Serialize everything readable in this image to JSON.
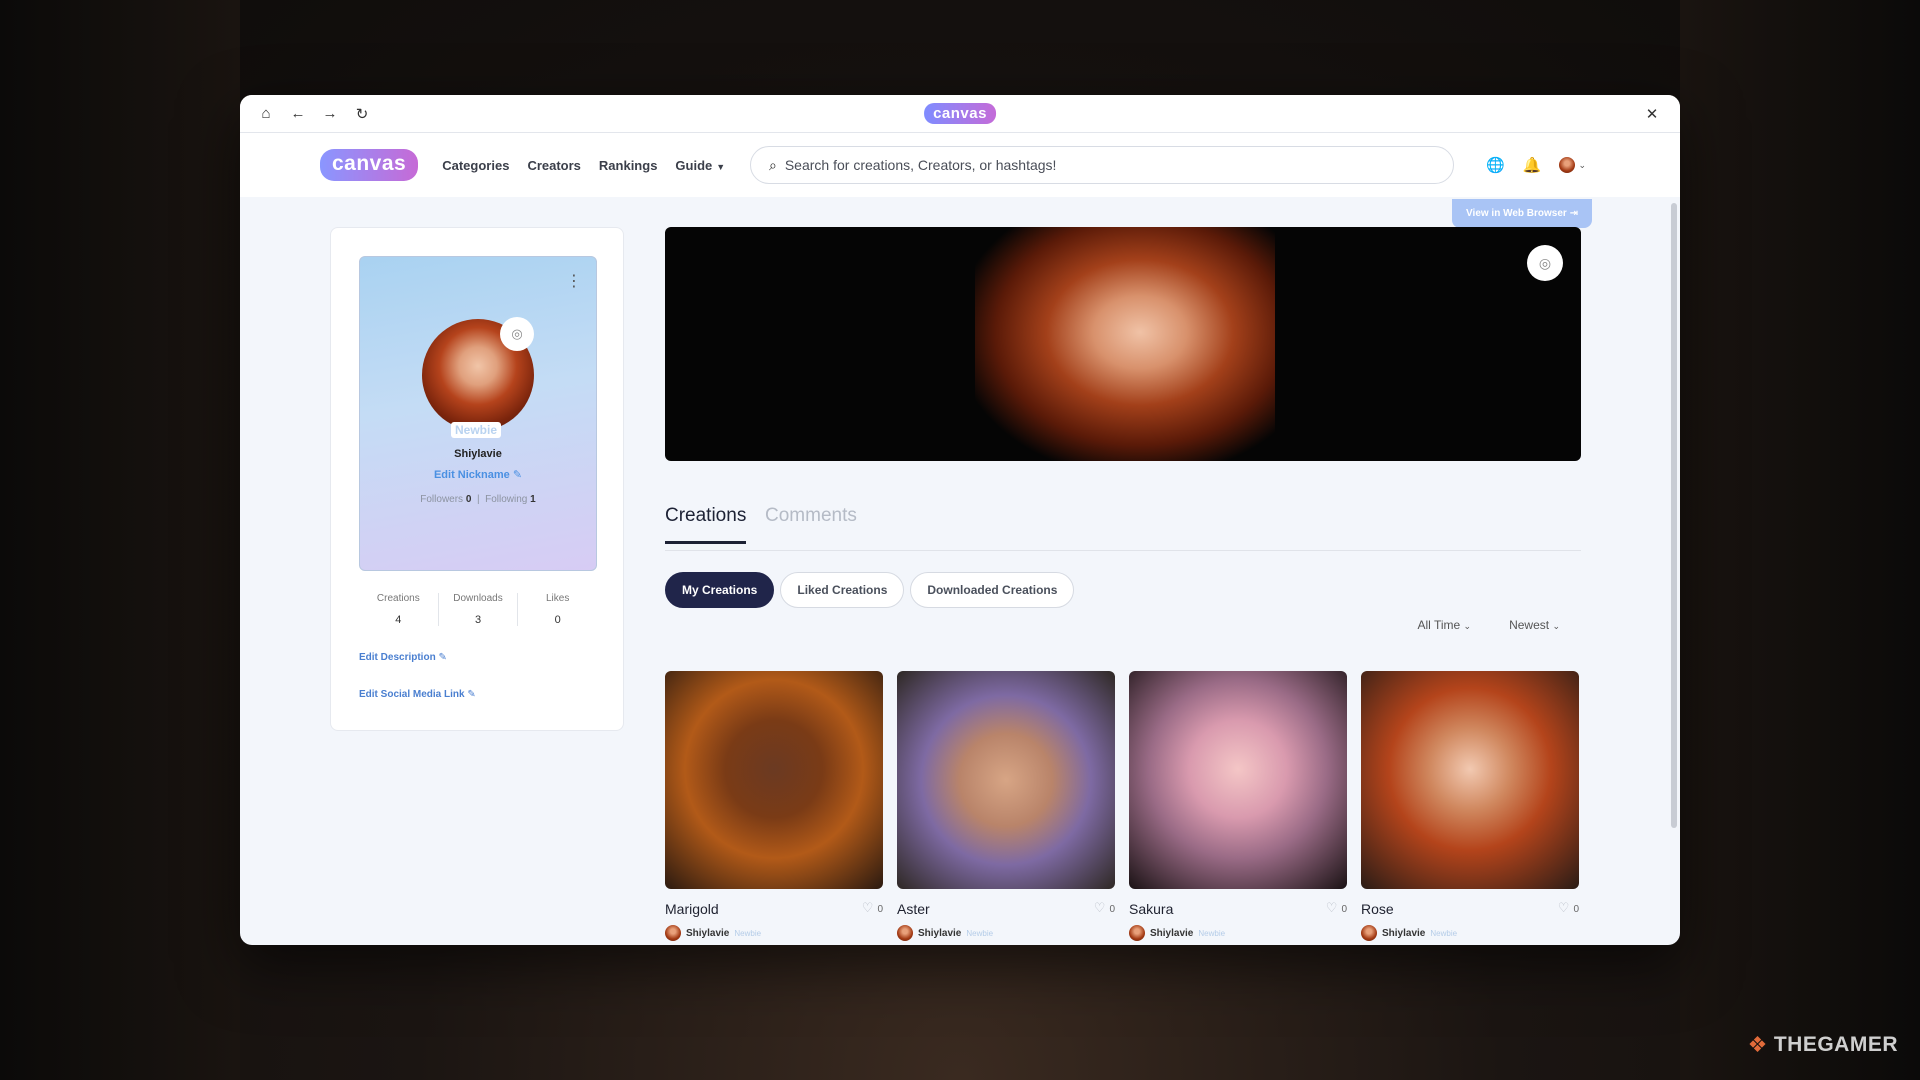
{
  "titlebar": {
    "home_icon": "home-icon",
    "back_icon": "arrow-left-icon",
    "forward_icon": "arrow-right-icon",
    "reload_icon": "reload-icon",
    "logo": "canvas",
    "close_icon": "close-icon"
  },
  "nav": {
    "brand": "canvas",
    "links": [
      "Categories",
      "Creators",
      "Rankings",
      "Guide"
    ],
    "search_placeholder": "Search for creations, Creators, or hashtags!",
    "view_web": "View in Web Browser"
  },
  "profile": {
    "badge": "Newbie",
    "name": "Shiylavie",
    "edit_nickname": "Edit Nickname",
    "followers_label": "Followers",
    "followers": "0",
    "following_label": "Following",
    "following": "1",
    "stats": [
      {
        "label": "Creations",
        "value": "4"
      },
      {
        "label": "Downloads",
        "value": "3"
      },
      {
        "label": "Likes",
        "value": "0"
      }
    ],
    "edit_description": "Edit Description",
    "edit_social": "Edit Social Media Link"
  },
  "tabs": {
    "creations": "Creations",
    "comments": "Comments"
  },
  "pills": [
    "My Creations",
    "Liked Creations",
    "Downloaded Creations"
  ],
  "filters": {
    "time": "All Time",
    "sort": "Newest"
  },
  "cards": [
    {
      "title": "Marigold",
      "likes": "0",
      "author": "Shiylavie",
      "badge": "Newbie"
    },
    {
      "title": "Aster",
      "likes": "0",
      "author": "Shiylavie",
      "badge": "Newbie"
    },
    {
      "title": "Sakura",
      "likes": "0",
      "author": "Shiylavie",
      "badge": "Newbie"
    },
    {
      "title": "Rose",
      "likes": "0",
      "author": "Shiylavie",
      "badge": "Newbie"
    }
  ],
  "watermark": "THEGAMER",
  "colors": {
    "accent_blue": "#4a90e2",
    "pill_active": "#20254a",
    "brand_gradient_start": "#8a96ff",
    "brand_gradient_end": "#c66ad6"
  }
}
